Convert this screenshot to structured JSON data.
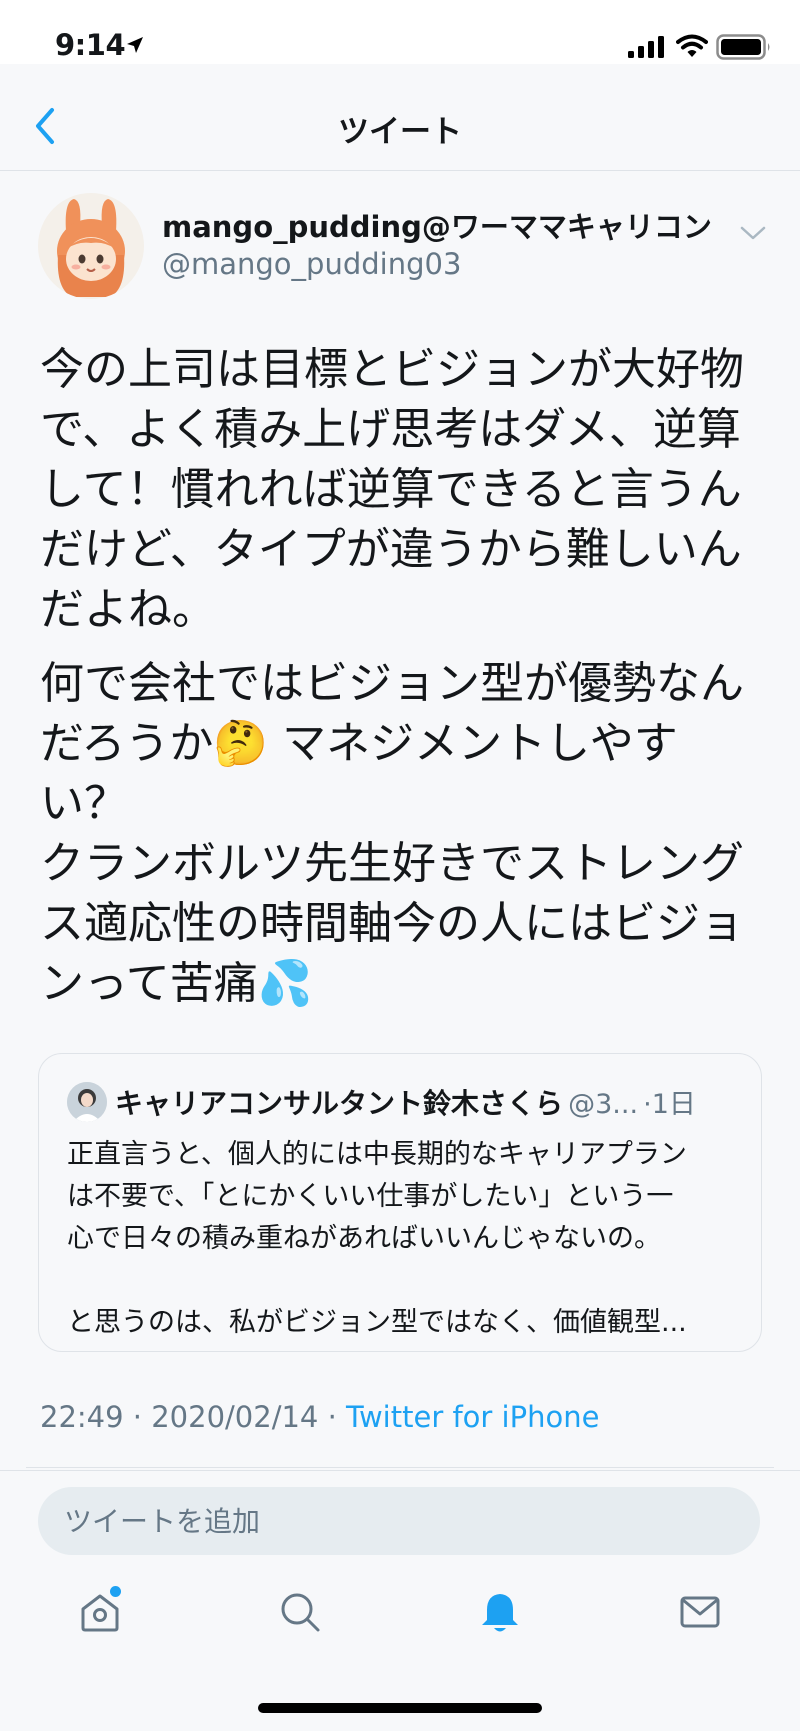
{
  "status_bar": {
    "time": "9:14"
  },
  "nav": {
    "title": "ツイート"
  },
  "tweet": {
    "author_name": "mango_pudding@ワーママキャリコン",
    "author_handle": "@mango_pudding03",
    "paragraphs": [
      "今の上司は目標とビジョンが大好物\nで、よく積み上げ思考はダメ、逆算\nして！慣れれば逆算できると言うん\nだけど、タイプが違うから難しいん\nだよね。",
      "何で会社ではビジョン型が優勢なん\nだろうか🤔 マネジメントしやすい？\nクランボルツ先生好きでストレング\nス適応性の時間軸今の人にはビジョ\nンって苦痛💦"
    ],
    "quoted": {
      "name": "キャリアコンサルタント鈴木さくら",
      "handle": "@3...",
      "time": "·1日",
      "text": "正直言うと、個人的には中長期的なキャリアプラン\nは不要で、「とにかくいい仕事がしたい」という一\n心で日々の積み重ねがあればいいんじゃないの。\n\nと思うのは、私がビジョン型ではなく、価値観型..."
    },
    "meta": {
      "time": "22:49",
      "separator": "·",
      "date": "2020/02/14",
      "client": "Twitter for iPhone"
    }
  },
  "reply": {
    "placeholder": "ツイートを追加"
  },
  "tabs": [
    {
      "icon": "home-icon"
    },
    {
      "icon": "search-icon"
    },
    {
      "icon": "bell-icon"
    },
    {
      "icon": "mail-icon"
    }
  ],
  "colors": {
    "accent": "#1da1f2",
    "muted": "#657786",
    "background": "#f7f8fa"
  }
}
